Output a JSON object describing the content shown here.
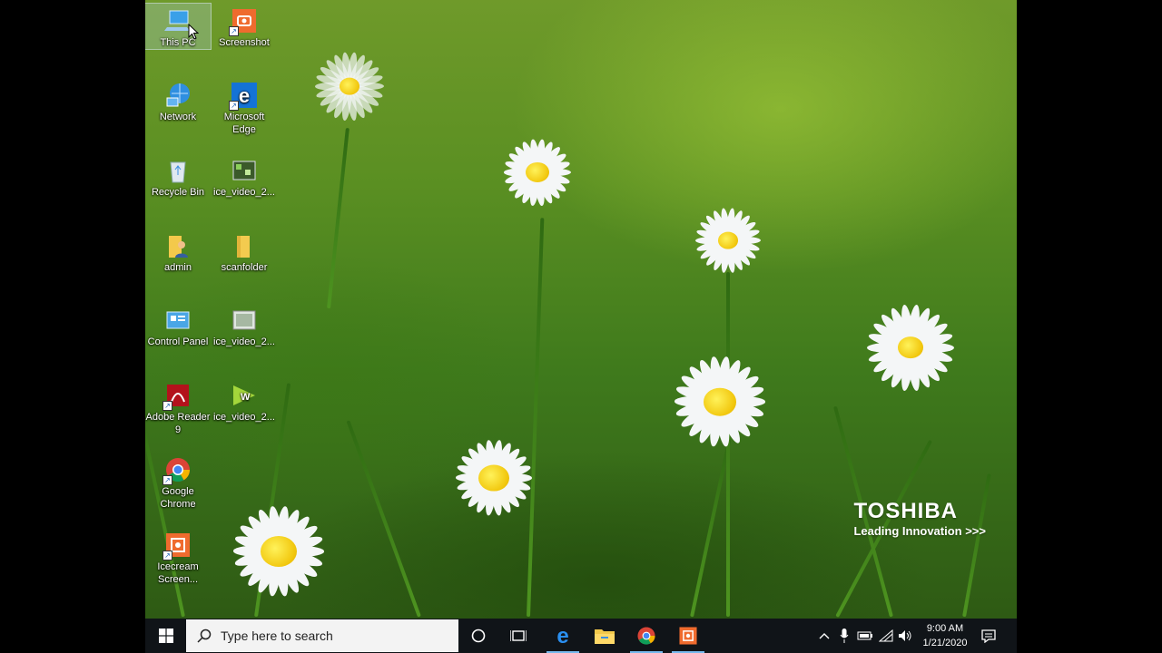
{
  "desktop": {
    "icons": [
      {
        "label": "This PC",
        "icon": "this-pc-icon"
      },
      {
        "label": "Screenshot",
        "icon": "screenshot-app-icon"
      },
      {
        "label": "Network",
        "icon": "network-icon"
      },
      {
        "label": "Microsoft Edge",
        "icon": "edge-icon"
      },
      {
        "label": "Recycle Bin",
        "icon": "recycle-bin-icon"
      },
      {
        "label": "ice_video_2...",
        "icon": "video-file-icon"
      },
      {
        "label": "admin",
        "icon": "user-folder-icon"
      },
      {
        "label": "scanfolder",
        "icon": "folder-icon"
      },
      {
        "label": "Control Panel",
        "icon": "control-panel-icon"
      },
      {
        "label": "ice_video_2...",
        "icon": "video-file-icon"
      },
      {
        "label": "Adobe Reader 9",
        "icon": "adobe-reader-icon"
      },
      {
        "label": "ice_video_2...",
        "icon": "wmv-file-icon"
      },
      {
        "label": "Google Chrome",
        "icon": "chrome-icon"
      },
      {
        "label": "Icecream Screen...",
        "icon": "icecream-screen-recorder-icon"
      }
    ]
  },
  "wallpaper": {
    "brand_name": "TOSHIBA",
    "brand_tagline": "Leading Innovation >>>"
  },
  "taskbar": {
    "search_placeholder": "Type here to search",
    "pinned": [
      "cortana-icon",
      "task-view-icon",
      "edge-icon",
      "file-explorer-icon",
      "chrome-icon",
      "icecream-screen-recorder-icon"
    ],
    "time": "9:00 AM",
    "date": "1/21/2020"
  },
  "colors": {
    "taskbar_bg": "#101418",
    "accent": "#76b9ed"
  }
}
